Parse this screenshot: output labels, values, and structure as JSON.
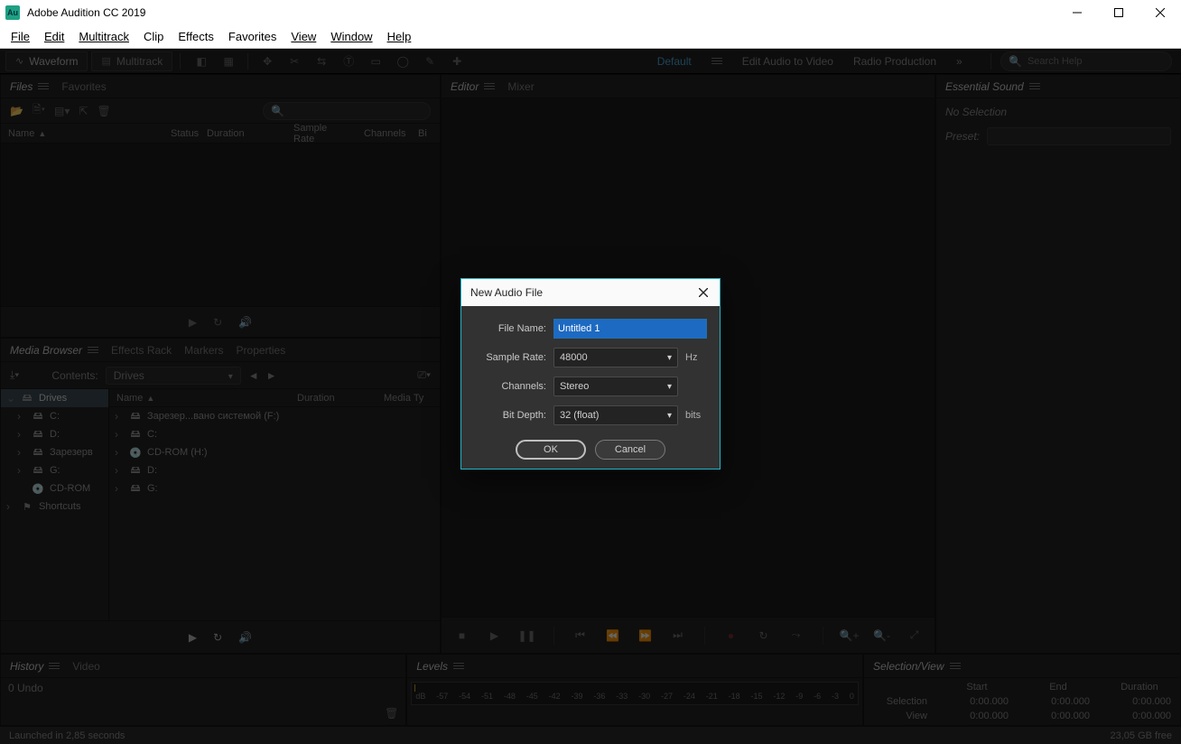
{
  "app": {
    "title": "Adobe Audition CC 2019",
    "icon_text": "Au"
  },
  "menu": [
    "File",
    "Edit",
    "Multitrack",
    "Clip",
    "Effects",
    "Favorites",
    "View",
    "Window",
    "Help"
  ],
  "modes": {
    "waveform": "Waveform",
    "multitrack": "Multitrack"
  },
  "workspaces": {
    "default": "Default",
    "edit_audio": "Edit Audio to Video",
    "radio": "Radio Production"
  },
  "search": {
    "placeholder": "Search Help"
  },
  "files_panel": {
    "tabs": {
      "files": "Files",
      "favorites": "Favorites"
    },
    "headers": {
      "name": "Name",
      "status": "Status",
      "duration": "Duration",
      "sample_rate": "Sample Rate",
      "channels": "Channels",
      "bit": "Bi"
    }
  },
  "media_panel": {
    "tabs": {
      "media": "Media Browser",
      "effects": "Effects Rack",
      "markers": "Markers",
      "properties": "Properties"
    },
    "contents_label": "Contents:",
    "contents_value": "Drives",
    "left": {
      "root": "Drives",
      "items": [
        "C:",
        "D:",
        "Зарезерв",
        "G:",
        "CD-ROM"
      ],
      "shortcuts": "Shortcuts"
    },
    "right": {
      "headers": {
        "name": "Name",
        "duration": "Duration",
        "media_type": "Media Ty"
      },
      "rows": [
        {
          "label": "Зарезер...вано системой (F:)"
        },
        {
          "label": "C:"
        },
        {
          "label": "CD-ROM (H:)"
        },
        {
          "label": "D:"
        },
        {
          "label": "G:"
        }
      ]
    }
  },
  "editor_panel": {
    "tabs": {
      "editor": "Editor",
      "mixer": "Mixer"
    }
  },
  "essential_panel": {
    "title": "Essential Sound",
    "no_selection": "No Selection",
    "preset_label": "Preset:"
  },
  "history_panel": {
    "tabs": {
      "history": "History",
      "video": "Video"
    },
    "undo_text": "0 Undo"
  },
  "levels_panel": {
    "title": "Levels",
    "ticks": [
      "dB",
      "-57",
      "-54",
      "-51",
      "-48",
      "-45",
      "-42",
      "-39",
      "-36",
      "-33",
      "-30",
      "-27",
      "-24",
      "-21",
      "-18",
      "-15",
      "-12",
      "-9",
      "-6",
      "-3",
      "0"
    ]
  },
  "selview_panel": {
    "title": "Selection/View",
    "headers": {
      "start": "Start",
      "end": "End",
      "duration": "Duration"
    },
    "rows": {
      "selection": {
        "label": "Selection",
        "start": "0:00.000",
        "end": "0:00.000",
        "duration": "0:00.000"
      },
      "view": {
        "label": "View",
        "start": "0:00.000",
        "end": "0:00.000",
        "duration": "0:00.000"
      }
    }
  },
  "status": {
    "left": "Launched in 2,85 seconds",
    "right": "23,05 GB free"
  },
  "dialog": {
    "title": "New Audio File",
    "file_name_label": "File Name:",
    "file_name_value": "Untitled 1",
    "sample_rate_label": "Sample Rate:",
    "sample_rate_value": "48000",
    "sample_rate_unit": "Hz",
    "channels_label": "Channels:",
    "channels_value": "Stereo",
    "bit_depth_label": "Bit Depth:",
    "bit_depth_value": "32 (float)",
    "bit_depth_unit": "bits",
    "ok": "OK",
    "cancel": "Cancel"
  }
}
